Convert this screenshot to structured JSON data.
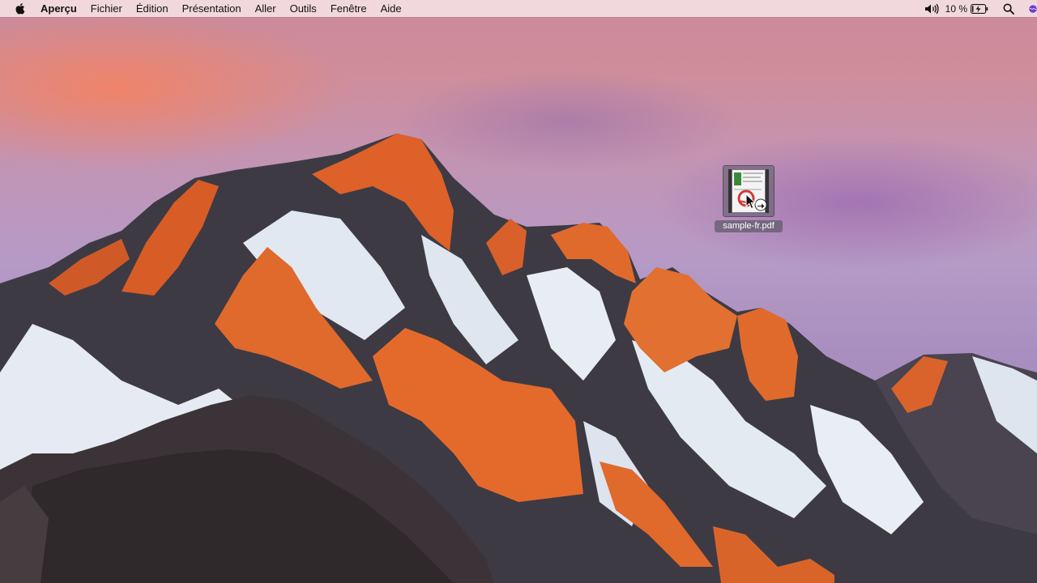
{
  "menubar": {
    "apple_icon": "apple-logo-icon",
    "app_name": "Aperçu",
    "menus": [
      "Fichier",
      "Édition",
      "Présentation",
      "Aller",
      "Outils",
      "Fenêtre",
      "Aide"
    ],
    "status": {
      "volume_icon": "speaker-icon",
      "battery_text": "10 %",
      "battery_icon": "battery-charging-icon",
      "battery_level": 0.1,
      "spotlight_icon": "search-icon",
      "siri_icon": "siri-icon"
    }
  },
  "desktop": {
    "file": {
      "name": "sample-fr.pdf",
      "icon": "pdf-document-icon",
      "badge_icon": "alias-arrow-icon"
    },
    "cursor_icon": "pointer-cursor-icon"
  },
  "colors": {
    "menubar_bg": "#f4dee2",
    "sky_pink": "#cf8d9a",
    "sky_purple": "#a98fbf",
    "peak_orange": "#d9612a",
    "snow": "#e8edf4",
    "rock_dark": "#3a3438"
  }
}
